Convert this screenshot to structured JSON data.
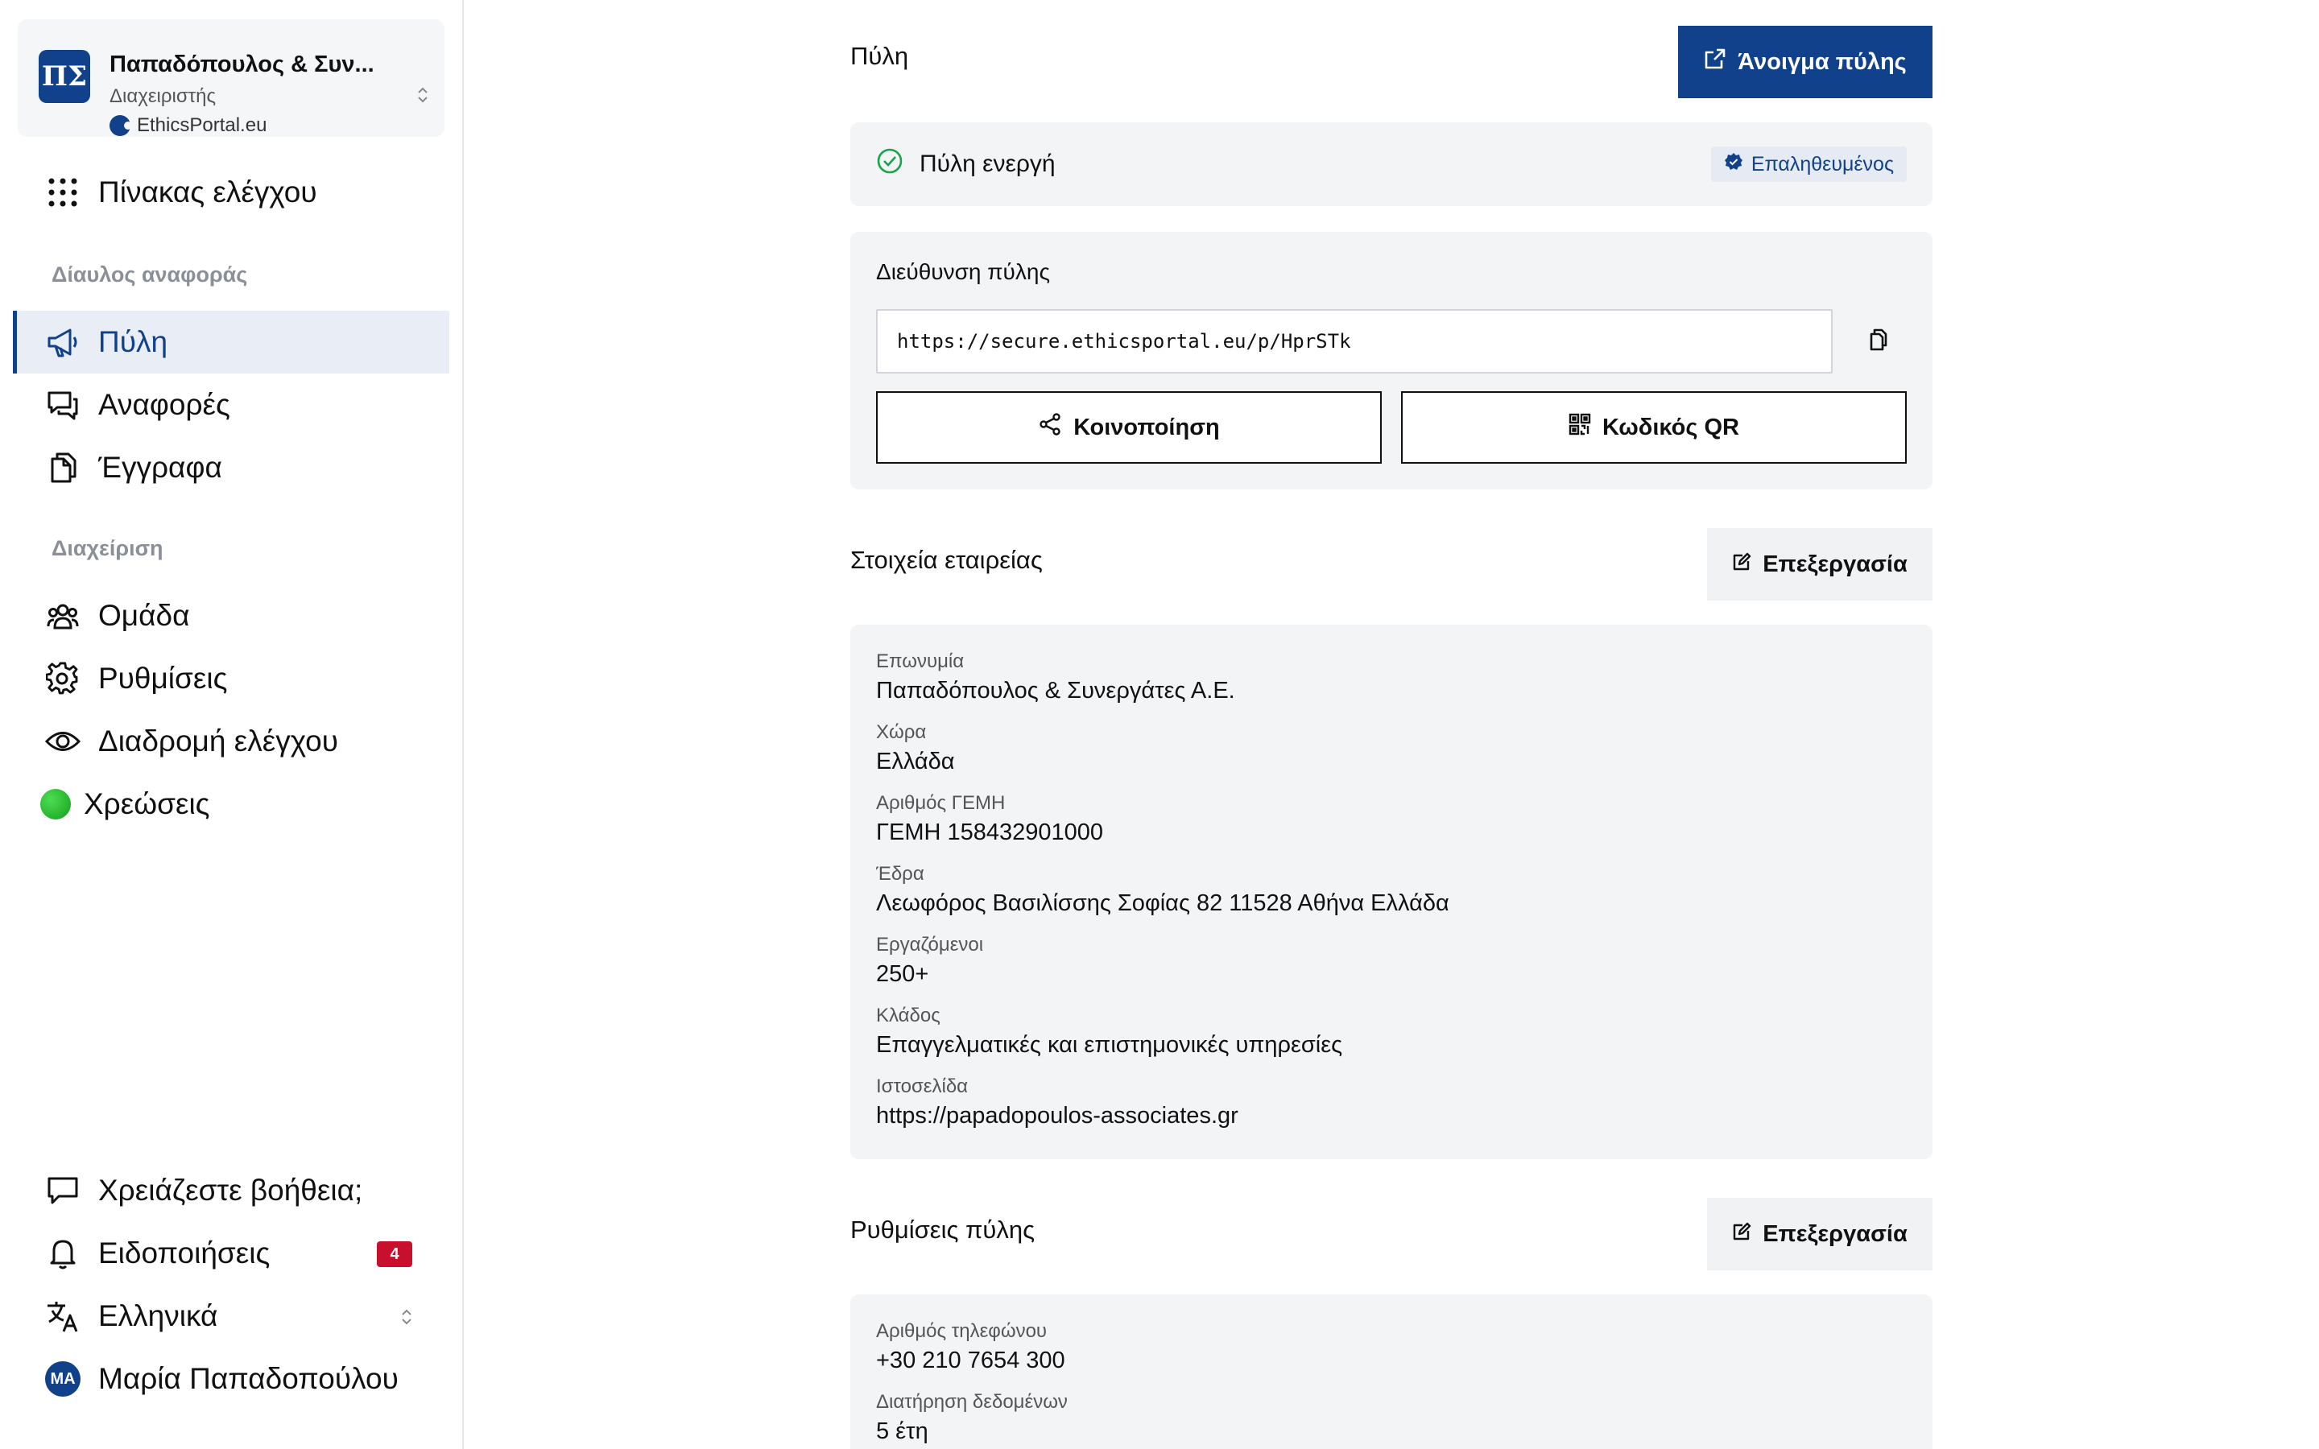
{
  "org": {
    "logo": "ΠΣ",
    "name": "Παπαδόπουλος & Συν...",
    "role": "Διαχειριστής",
    "site": "EthicsPortal.eu"
  },
  "nav": {
    "dashboard": "Πίνακας ελέγχου",
    "section_channel": "Δίαυλος αναφοράς",
    "portal": "Πύλη",
    "reports": "Αναφορές",
    "documents": "Έγγραφα",
    "section_admin": "Διαχείριση",
    "team": "Ομάδα",
    "settings": "Ρυθμίσεις",
    "audit": "Διαδρομή ελέγχου",
    "billing": "Χρεώσεις",
    "help": "Χρειάζεστε βοήθεια;",
    "notifications": "Ειδοποιήσεις",
    "notifications_count": "4",
    "language": "Ελληνικά",
    "user_initials": "MA",
    "user_name": "Μαρία Παπαδοπούλου"
  },
  "portal": {
    "title": "Πύλη",
    "open_button": "Άνοιγμα πύλης",
    "status": "Πύλη ενεργή",
    "verified": "Επαληθευμένος",
    "url_label": "Διεύθυνση πύλης",
    "url": "https://secure.ethicsportal.eu/p/HprSTk",
    "share_button": "Κοινοποίηση",
    "qr_button": "Κωδικός QR"
  },
  "company": {
    "title": "Στοιχεία εταιρείας",
    "edit_button": "Επεξεργασία",
    "fields": [
      {
        "label": "Επωνυμία",
        "value": "Παπαδόπουλος & Συνεργάτες Α.Ε."
      },
      {
        "label": "Χώρα",
        "value": "Ελλάδα"
      },
      {
        "label": "Αριθμός ΓΕΜΗ",
        "value": "ΓΕΜΗ 158432901000"
      },
      {
        "label": "Έδρα",
        "value": "Λεωφόρος Βασιλίσσης Σοφίας 82 11528 Αθήνα Ελλάδα"
      },
      {
        "label": "Εργαζόμενοι",
        "value": "250+"
      },
      {
        "label": "Κλάδος",
        "value": "Επαγγελματικές και επιστημονικές υπηρεσίες"
      },
      {
        "label": "Ιστοσελίδα",
        "value": "https://papadopoulos-associates.gr"
      }
    ]
  },
  "portal_settings": {
    "title": "Ρυθμίσεις πύλης",
    "edit_button": "Επεξεργασία",
    "fields": [
      {
        "label": "Αριθμός τηλεφώνου",
        "value": "+30 210 7654 300"
      },
      {
        "label": "Διατήρηση δεδομένων",
        "value": "5 έτη"
      }
    ]
  },
  "colors": {
    "brand": "#10418a",
    "active_bg": "#e9eef6",
    "badge": "#c8102e",
    "success": "#16a34a"
  }
}
